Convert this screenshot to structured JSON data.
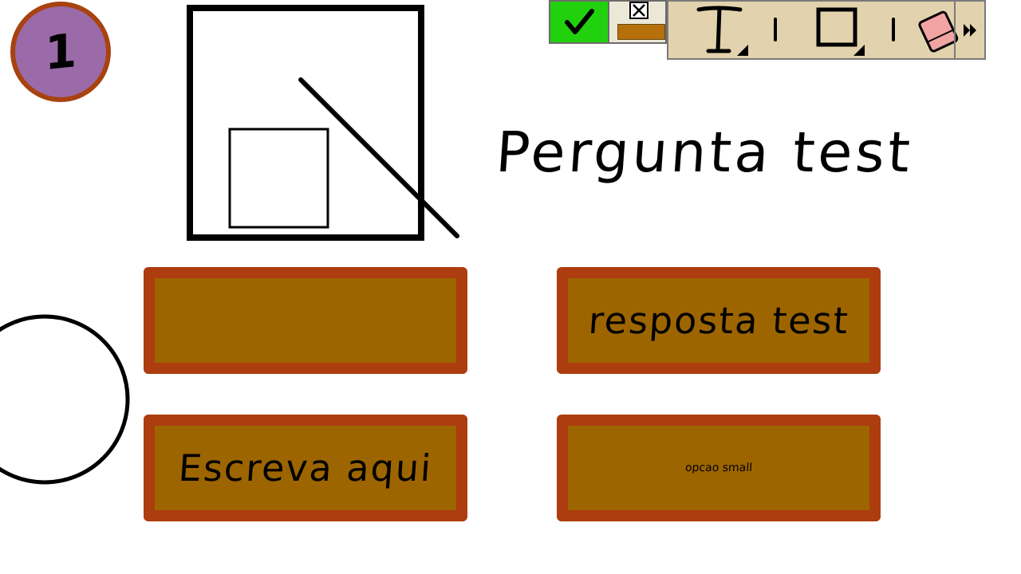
{
  "quiz": {
    "question_number": "1",
    "question_title": "Pergunta test"
  },
  "answers": [
    {
      "text": ""
    },
    {
      "text": "resposta test"
    },
    {
      "text": "Escreva aqui"
    },
    {
      "text": "opcao small"
    }
  ],
  "toolbar": {
    "confirm_icon": "checkmark-icon",
    "cancel_icon": "close-box-icon",
    "tools": [
      "text-tool-icon",
      "rectangle-tool-icon",
      "eraser-tool-icon"
    ],
    "more_icon": "double-chevron-right-icon"
  },
  "colors": {
    "answer_fill": "#9d6500",
    "answer_border": "#ad3c0e",
    "badge_fill": "#9b6aa8",
    "confirm_green": "#22d10d",
    "toolbar_bg": "#e2d2ae"
  }
}
